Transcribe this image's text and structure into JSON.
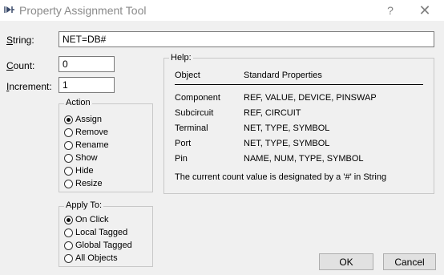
{
  "window": {
    "title": "Property Assignment Tool",
    "help_button": "?",
    "close_button": "✕"
  },
  "form": {
    "string_label": "String:",
    "string_value": "NET=DB#",
    "count_label": "Count:",
    "count_value": "0",
    "increment_label": "Increment:",
    "increment_value": "1"
  },
  "action": {
    "title": "Action",
    "options": [
      "Assign",
      "Remove",
      "Rename",
      "Show",
      "Hide",
      "Resize"
    ],
    "selected": "Assign"
  },
  "apply_to": {
    "title": "Apply To:",
    "options": [
      "On Click",
      "Local Tagged",
      "Global Tagged",
      "All Objects"
    ],
    "selected": "On Click"
  },
  "help": {
    "title": "Help:",
    "col_object": "Object",
    "col_props": "Standard Properties",
    "rows": [
      {
        "object": "Component",
        "props": "REF, VALUE, DEVICE, PINSWAP"
      },
      {
        "object": "Subcircuit",
        "props": "REF, CIRCUIT"
      },
      {
        "object": "Terminal",
        "props": "NET, TYPE, SYMBOL"
      },
      {
        "object": "Port",
        "props": "NET, TYPE, SYMBOL"
      },
      {
        "object": "Pin",
        "props": "NAME, NUM, TYPE, SYMBOL"
      }
    ],
    "note": "The current count value is designated by a '#' in String"
  },
  "buttons": {
    "ok": "OK",
    "cancel": "Cancel"
  }
}
